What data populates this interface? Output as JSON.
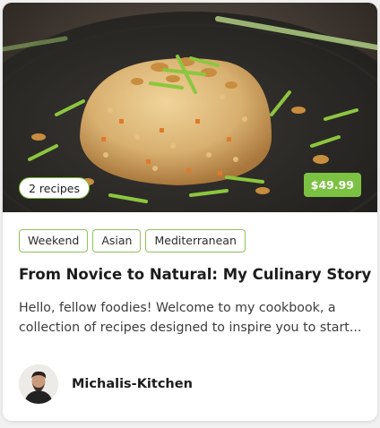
{
  "card": {
    "image": {
      "alt": "fried rice",
      "recipes_badge": "2 recipes",
      "price": "$49.99"
    },
    "tags": [
      "Weekend",
      "Asian",
      "Mediterranean"
    ],
    "title": "From Novice to Natural: My Culinary Story",
    "description": "Hello, fellow foodies! Welcome to my cookbook, a collection of recipes designed to inspire you to start...",
    "author": {
      "name": "Michalis-Kitchen"
    }
  },
  "colors": {
    "accent_green": "#7cc242",
    "tag_border": "#8fc45a"
  }
}
